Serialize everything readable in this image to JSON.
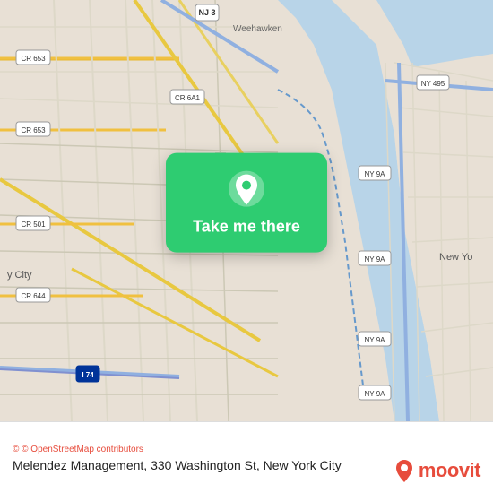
{
  "map": {
    "alt": "Map of New York City area showing New Jersey and Manhattan"
  },
  "overlay": {
    "button_label": "Take me there",
    "pin_icon": "location-pin"
  },
  "footer": {
    "osm_credit": "© OpenStreetMap contributors",
    "address": "Melendez Management, 330 Washington St, New York City"
  },
  "branding": {
    "logo_text": "moovit",
    "logo_icon": "moovit-pin"
  }
}
